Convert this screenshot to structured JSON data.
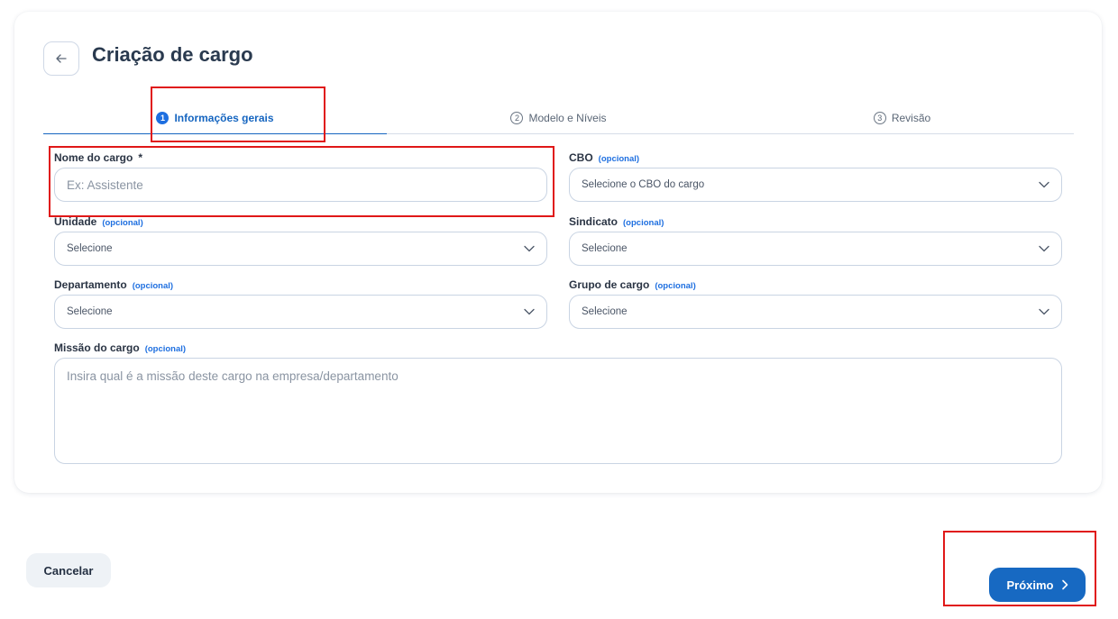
{
  "header": {
    "title": "Criação de cargo",
    "back_icon": "arrow-left-icon"
  },
  "tabs": [
    {
      "num": "1",
      "label": "Informações gerais",
      "active": true
    },
    {
      "num": "2",
      "label": "Modelo e Níveis",
      "active": false
    },
    {
      "num": "3",
      "label": "Revisão",
      "active": false
    }
  ],
  "form": {
    "nome": {
      "label": "Nome do cargo",
      "required": "*",
      "placeholder": "Ex: Assistente"
    },
    "cbo": {
      "label": "CBO",
      "optional": "(opcional)",
      "value": "Selecione o CBO do cargo"
    },
    "unidade": {
      "label": "Unidade",
      "optional": "(opcional)",
      "value": "Selecione"
    },
    "sindicato": {
      "label": "Sindicato",
      "optional": "(opcional)",
      "value": "Selecione"
    },
    "departamento": {
      "label": "Departamento",
      "optional": "(opcional)",
      "value": "Selecione"
    },
    "grupo": {
      "label": "Grupo de cargo",
      "optional": "(opcional)",
      "value": "Selecione"
    },
    "missao": {
      "label": "Missão do cargo",
      "optional": "(opcional)",
      "placeholder": "Insira qual é a missão deste cargo na empresa/departamento"
    }
  },
  "footer": {
    "cancel_label": "Cancelar",
    "next_label": "Próximo"
  },
  "colors": {
    "accent": "#1769c2",
    "highlight": "#e01818"
  }
}
